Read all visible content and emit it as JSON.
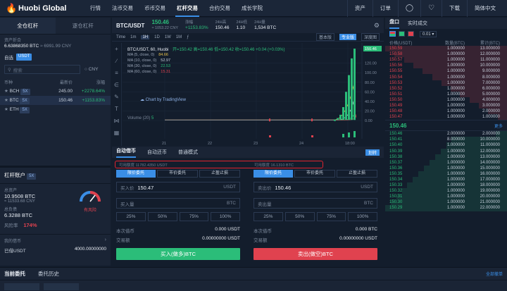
{
  "nav": {
    "logo": "Huobi Global",
    "items": [
      "行情",
      "法币交易",
      "币币交易",
      "杠杆交易",
      "合约交易",
      "成长学院"
    ],
    "active_index": 3,
    "right": [
      "资产",
      "订单",
      "下载",
      "简体中文"
    ]
  },
  "left": {
    "tabs": [
      "全仓杠杆",
      "逐仓杠杆"
    ],
    "asset_label": "资产折合",
    "asset_value": "6.63868350 BTC",
    "asset_cny": "≈ 6991.99 CNY",
    "filters": [
      "自选",
      "USDT"
    ],
    "search_placeholder": "搜索",
    "cny_label": "CNY",
    "columns": [
      "币种",
      "最新价",
      "涨幅"
    ],
    "markets": [
      {
        "coin": "BCH",
        "lev": "5X",
        "price": "245.00",
        "change": "+2278.64%"
      },
      {
        "coin": "BTC",
        "lev": "5X",
        "price": "150.46",
        "change": "+1153.83%"
      },
      {
        "coin": "ETH",
        "lev": "5X",
        "price": "",
        "change": ""
      }
    ],
    "account_title": "杠杆账户",
    "account_lev": "5X",
    "total_asset_label": "总资产",
    "total_asset": "10.9508 BTC",
    "total_asset_cny": "≈ 11533.68 CNY",
    "total_debt_label": "总负债",
    "total_debt": "6.3288 BTC",
    "risk_label": "风险率",
    "risk_value": "174%",
    "risk_status": "有风险",
    "my_debt_label": "我的借币",
    "borrowed_label": "已借USDT",
    "borrowed_value": "4000.00000000"
  },
  "chart": {
    "pair": "BTC/USDT",
    "last": "150.46",
    "last_cny": "≈ 1053.22 CNY",
    "change_label": "涨幅",
    "change": "+1153.83%",
    "high_label": "24H高",
    "high": "150.46",
    "low_label": "24H低",
    "low": "1.10",
    "vol_label": "24H量",
    "vol": "1,534 BTC",
    "intervals": [
      "Time",
      "1m",
      "1H",
      "1D",
      "1W",
      "1M"
    ],
    "views": [
      "基本版",
      "专业版",
      "深度图"
    ],
    "legend": "BTC/USDT, 60, Huobi",
    "ohlc": "开=150.42  高=150.46  低=150.42  收=150.46  +0.04 (+0.03%)",
    "ma": [
      {
        "label": "MA (5, close, 0)",
        "value": "84.66",
        "color": "#e8c14a"
      },
      {
        "label": "MA (10, close, 0)",
        "value": "52.97",
        "color": "#c9d2de"
      },
      {
        "label": "MA (30, close, 0)",
        "value": "22.53",
        "color": "#2bbd79"
      },
      {
        "label": "MA (60, close, 0)",
        "value": "15.31",
        "color": "#e0424f"
      }
    ],
    "tv_label": "Chart by TradingView",
    "volume_label": "Volume (20)",
    "volume_value": "5",
    "y_ticks": [
      "150.46",
      "120.00",
      "100.00",
      "80.00",
      "60.00",
      "40.00",
      "20.00",
      "0.00"
    ],
    "x_ticks": [
      "21",
      "22",
      "23",
      "24",
      "18:00"
    ]
  },
  "order": {
    "tabs": [
      "自动借币",
      "自动还币",
      "普通模式"
    ],
    "switch_label": "划转",
    "avail_buy": "可用额度 11782.4350 USDT",
    "avail_sell": "可用额度 16.1310 BTC",
    "buy_types": [
      "限价委托",
      "市价委托",
      "止盈止损"
    ],
    "sell_types": [
      "限价委托",
      "市价委托",
      "止盈止损"
    ],
    "buy_price_label": "买入价",
    "buy_price": "150.47",
    "sell_price_label": "卖出价",
    "sell_price": "150.46",
    "unit_usdt": "USDT",
    "unit_btc": "BTC",
    "buy_qty_label": "买入量",
    "sell_qty_label": "卖出量",
    "pcts": [
      "25%",
      "50%",
      "75%",
      "100%"
    ],
    "borrow_label": "本次借币",
    "borrow_buy": "0.000 USDT",
    "borrow_sell": "0.000 BTC",
    "amount_label": "交易额",
    "amount_buy": "0.00000000 USDT",
    "amount_sell": "0.00000000 USDT",
    "buy_button": "买入(做多)BTC",
    "sell_button": "卖出(做空)BTC"
  },
  "book": {
    "tabs": [
      "盘口",
      "实时成交"
    ],
    "precision": "0.01",
    "columns": [
      "价格(USDT)",
      "数量(BTC)",
      "累计(BTC)"
    ],
    "asks": [
      {
        "p": "150.59",
        "a": "1.000000",
        "s": "13.000000"
      },
      {
        "p": "150.58",
        "a": "1.000000",
        "s": "12.000000"
      },
      {
        "p": "150.57",
        "a": "1.000000",
        "s": "11.000000"
      },
      {
        "p": "150.56",
        "a": "1.000000",
        "s": "10.000000"
      },
      {
        "p": "150.55",
        "a": "1.000000",
        "s": "9.000000"
      },
      {
        "p": "150.54",
        "a": "1.000000",
        "s": "8.000000"
      },
      {
        "p": "150.53",
        "a": "1.000000",
        "s": "7.000000"
      },
      {
        "p": "150.52",
        "a": "1.000000",
        "s": "6.000000"
      },
      {
        "p": "150.51",
        "a": "1.000000",
        "s": "5.000000"
      },
      {
        "p": "150.50",
        "a": "1.000000",
        "s": "4.000000"
      },
      {
        "p": "150.49",
        "a": "1.000000",
        "s": "3.000000"
      },
      {
        "p": "150.48",
        "a": "1.000000",
        "s": "2.000000"
      },
      {
        "p": "150.47",
        "a": "1.000000",
        "s": "1.000000"
      }
    ],
    "mid_price": "150.46",
    "more": "更多",
    "bids": [
      {
        "p": "150.46",
        "a": "2.000000",
        "s": "2.000000"
      },
      {
        "p": "150.41",
        "a": "8.000000",
        "s": "10.000000"
      },
      {
        "p": "150.40",
        "a": "1.000000",
        "s": "11.000000"
      },
      {
        "p": "150.39",
        "a": "1.000000",
        "s": "12.000000"
      },
      {
        "p": "150.38",
        "a": "1.000000",
        "s": "13.000000"
      },
      {
        "p": "150.37",
        "a": "1.000000",
        "s": "14.000000"
      },
      {
        "p": "150.36",
        "a": "1.000000",
        "s": "15.000000"
      },
      {
        "p": "150.35",
        "a": "1.000000",
        "s": "16.000000"
      },
      {
        "p": "150.34",
        "a": "1.000000",
        "s": "17.000000"
      },
      {
        "p": "150.33",
        "a": "1.000000",
        "s": "18.000000"
      },
      {
        "p": "150.32",
        "a": "1.000000",
        "s": "19.000000"
      },
      {
        "p": "150.31",
        "a": "1.000000",
        "s": "20.000000"
      },
      {
        "p": "150.30",
        "a": "1.000000",
        "s": "21.000000"
      },
      {
        "p": "150.29",
        "a": "1.000000",
        "s": "22.000000"
      }
    ]
  },
  "bottom": {
    "tabs": [
      "当前委托",
      "委托历史"
    ],
    "all": "全部撤单"
  }
}
